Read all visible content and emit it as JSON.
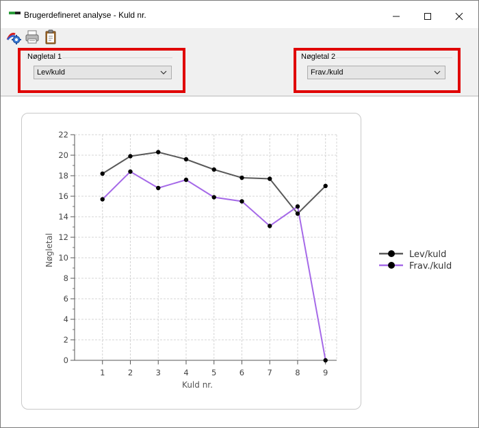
{
  "window": {
    "title": "Brugerdefineret analyse - Kuld nr."
  },
  "toolbar": {
    "icons": [
      "settings-chart-icon",
      "printer-icon",
      "clipboard-icon"
    ]
  },
  "filters": {
    "noegletal1": {
      "label": "Nøgletal 1",
      "value": "Lev/kuld"
    },
    "noegletal2": {
      "label": "Nøgletal 2",
      "value": "Frav./kuld"
    }
  },
  "colors": {
    "highlight": "#e00000",
    "series1": "#595959",
    "series2": "#a569e8"
  },
  "chart_data": {
    "type": "line",
    "xlabel": "Kuld nr.",
    "ylabel": "Nøgletal",
    "x": [
      1,
      2,
      3,
      4,
      5,
      6,
      7,
      8,
      9
    ],
    "ylim": [
      0,
      22
    ],
    "yticks": [
      0,
      2,
      4,
      6,
      8,
      10,
      12,
      14,
      16,
      18,
      20,
      22
    ],
    "grid": true,
    "legend_position": "right",
    "series": [
      {
        "name": "Lev/kuld",
        "color": "#595959",
        "values": [
          18.2,
          19.9,
          20.3,
          19.6,
          18.6,
          17.8,
          17.7,
          14.3,
          17.0
        ]
      },
      {
        "name": "Frav./kuld",
        "color": "#a569e8",
        "values": [
          15.7,
          18.4,
          16.8,
          17.6,
          15.9,
          15.5,
          13.1,
          15.0,
          0.0
        ]
      }
    ]
  }
}
